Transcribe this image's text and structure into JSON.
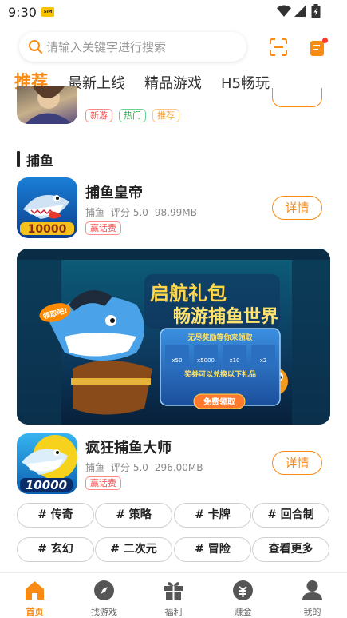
{
  "status_bar": {
    "time": "9:30",
    "sim_label": "SIM"
  },
  "search": {
    "placeholder": "请输入关键字进行搜索",
    "value": ""
  },
  "tabs": [
    {
      "label": "推荐",
      "active": true
    },
    {
      "label": "最新上线",
      "active": false
    },
    {
      "label": "精品游戏",
      "active": false
    },
    {
      "label": "H5畅玩",
      "active": false
    }
  ],
  "top_item": {
    "tags": [
      "新游",
      "热门",
      "推荐"
    ]
  },
  "section": {
    "title": "捕鱼"
  },
  "games": [
    {
      "name": "捕鱼皇帝",
      "category": "捕鱼",
      "rating": "评分 5.0",
      "size": "98.99MB",
      "tag": "赢话费",
      "button": "详情",
      "icon_text": "10000"
    },
    {
      "name": "疯狂捕鱼大师",
      "category": "捕鱼",
      "rating": "评分 5.0",
      "size": "296.00MB",
      "tag": "赢话费",
      "button": "详情",
      "icon_text": "10000"
    }
  ],
  "banner": {
    "title_line1": "启航礼包",
    "title_line2": "畅游捕鱼世界",
    "sub": "无尽奖励等你来领取",
    "sub2": "奖券可以兑换以下礼品",
    "cta": "免费领取",
    "badge": "领取吧!",
    "rewards": [
      "x50",
      "x5000",
      "x10",
      "x2"
    ]
  },
  "chips": [
    "# 传奇",
    "# 策略",
    "# 卡牌",
    "# 回合制",
    "# 玄幻",
    "# 二次元",
    "# 冒险",
    "查看更多"
  ],
  "bottom_nav": [
    {
      "label": "首页",
      "icon": "home-icon",
      "active": true
    },
    {
      "label": "找游戏",
      "icon": "compass-icon",
      "active": false
    },
    {
      "label": "福利",
      "icon": "gift-icon",
      "active": false
    },
    {
      "label": "赚金",
      "icon": "coin-bag-icon",
      "active": false
    },
    {
      "label": "我的",
      "icon": "user-icon",
      "active": false
    }
  ],
  "colors": {
    "accent": "#f98a13",
    "tag_red": "#ff4b4b",
    "tag_green": "#22b14c"
  }
}
